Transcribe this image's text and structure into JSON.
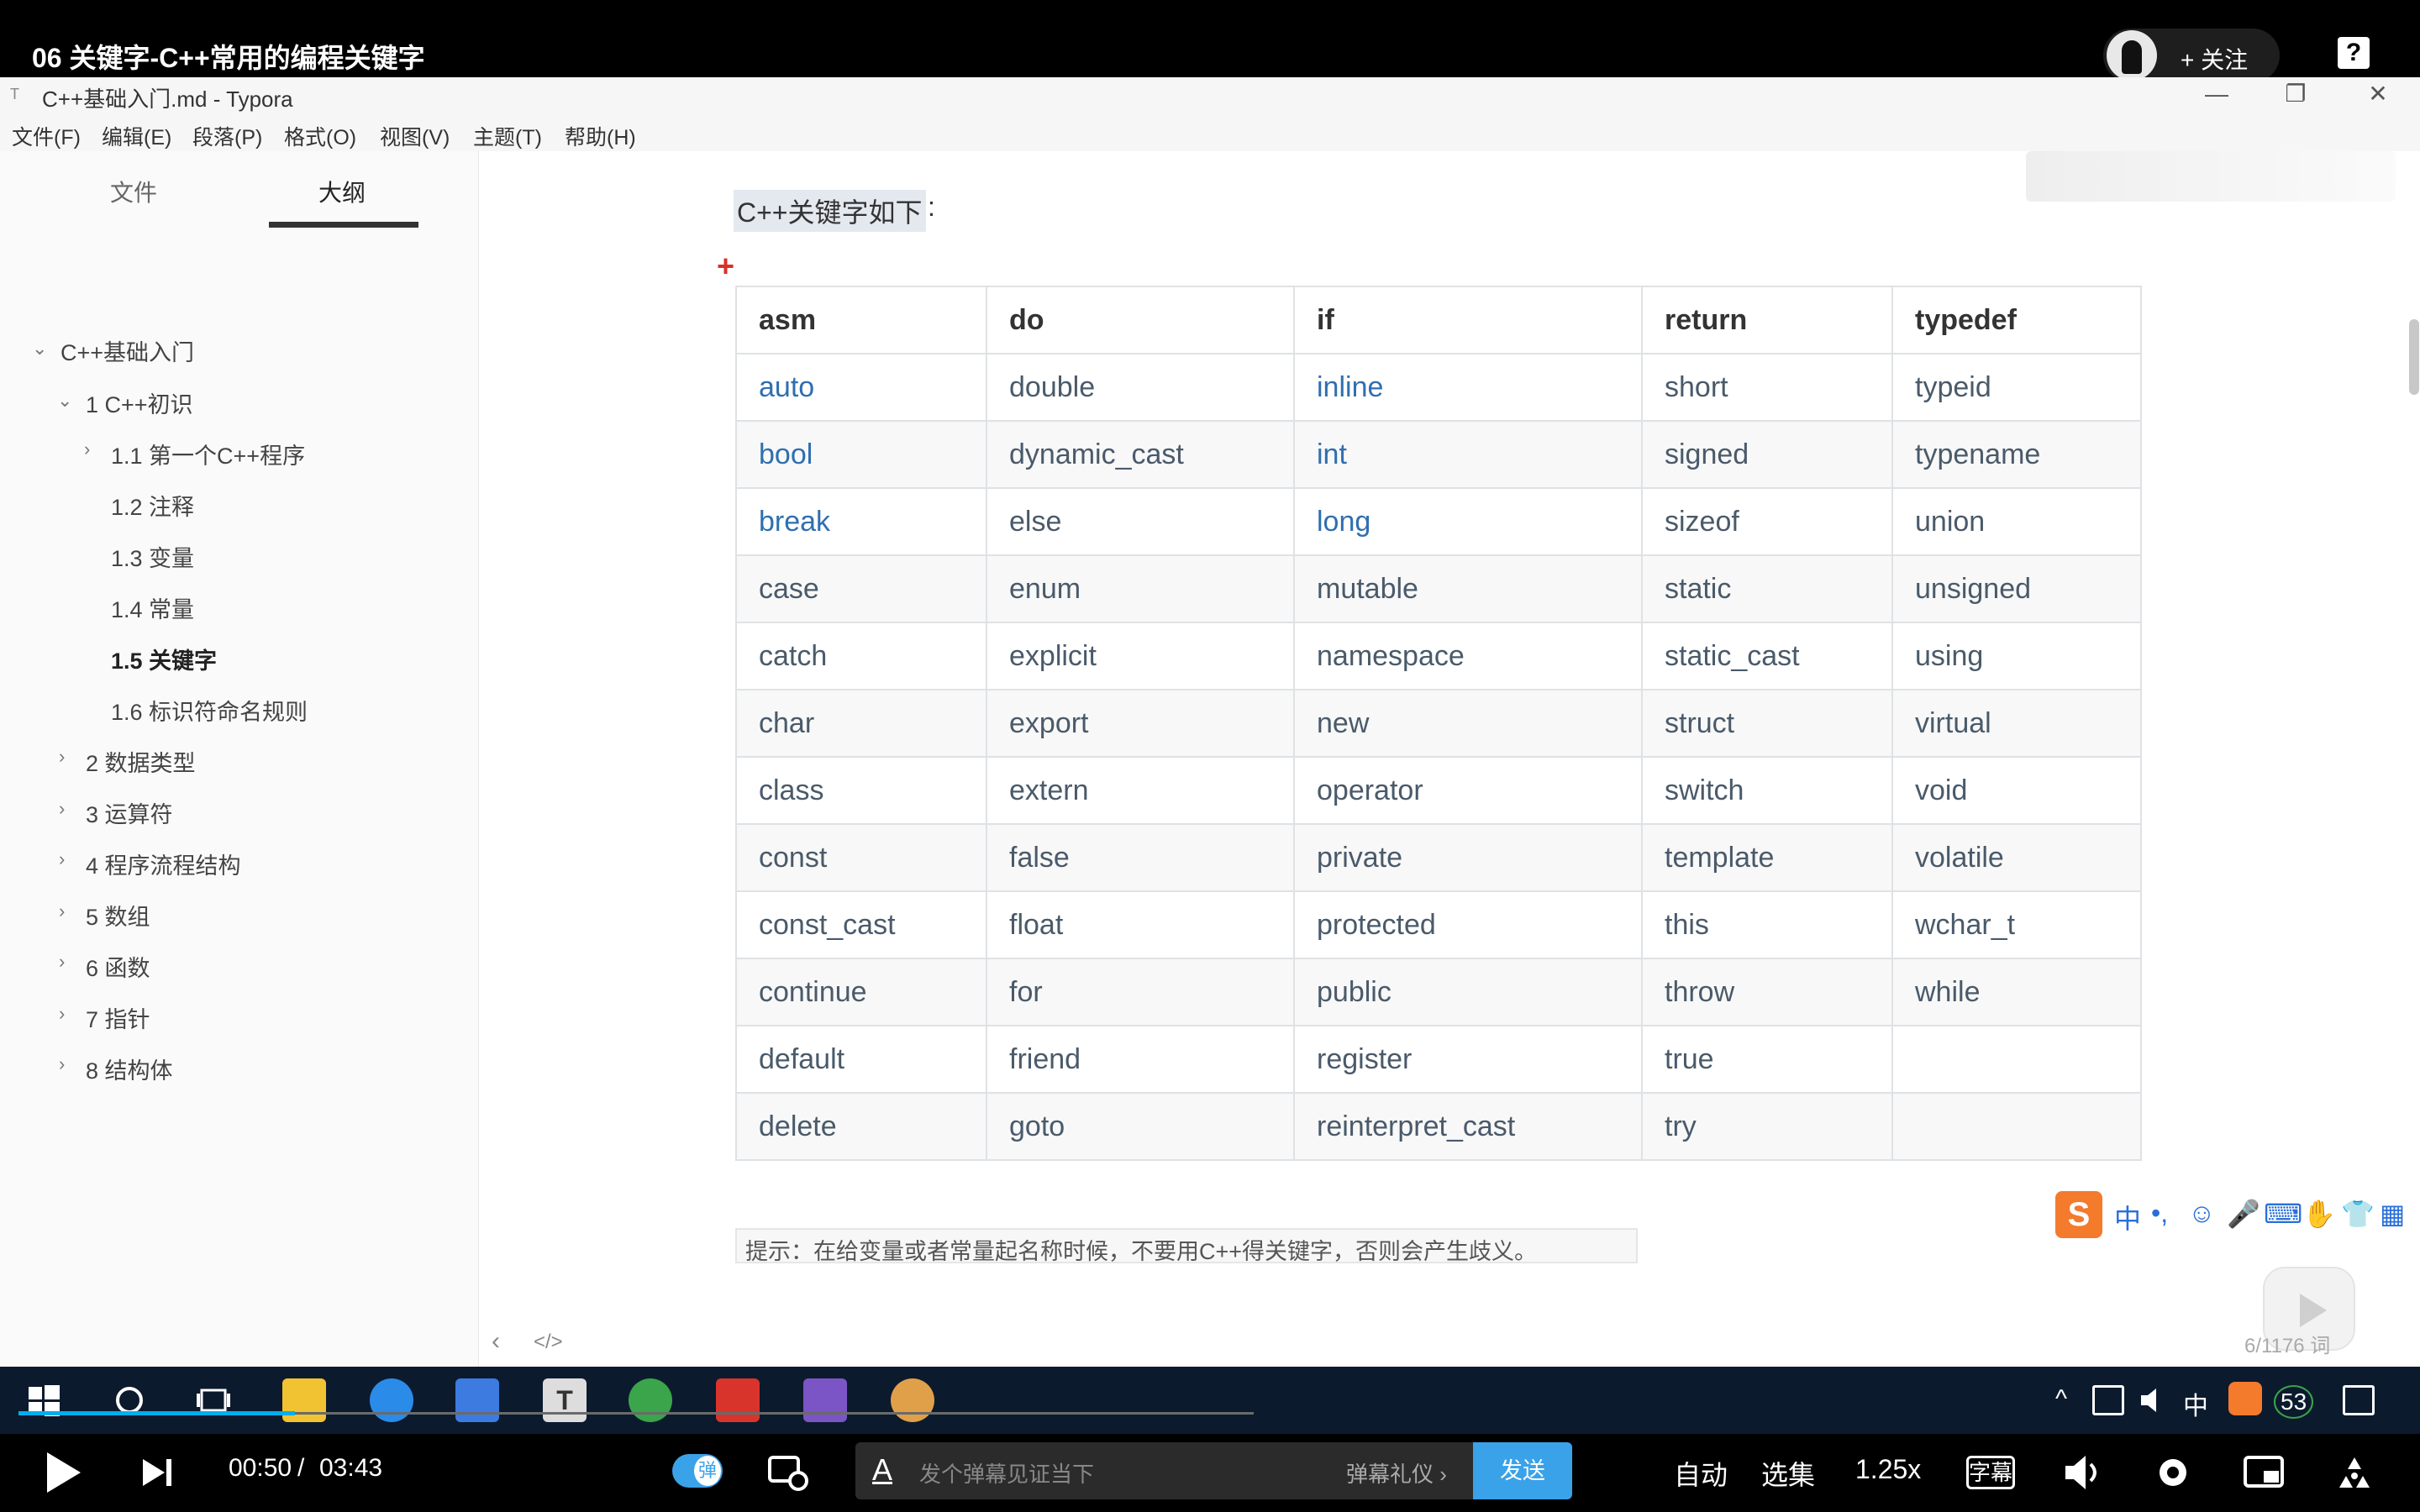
{
  "video": {
    "title": "06 关键字-C++常用的编程关键字",
    "follow_label": "+ 关注",
    "help_glyph": "?"
  },
  "window": {
    "title": "C++基础入门.md - Typora",
    "controls": {
      "minimize": "—",
      "restore": "❐",
      "close": "✕"
    },
    "menu": [
      "文件(F)",
      "编辑(E)",
      "段落(P)",
      "格式(O)",
      "视图(V)",
      "主题(T)",
      "帮助(H)"
    ]
  },
  "sidebar": {
    "tabs": [
      "文件",
      "大纲"
    ],
    "active_tab": "大纲",
    "outline": [
      {
        "label": "C++基础入门",
        "chevron": "⌄"
      },
      {
        "label": "1 C++初识",
        "chevron": "⌄"
      },
      {
        "label": "1.1 第一个C++程序",
        "chevron": "›"
      },
      {
        "label": "1.2 注释"
      },
      {
        "label": "1.3 变量"
      },
      {
        "label": "1.4 常量"
      },
      {
        "label": "1.5 关键字",
        "active": true
      },
      {
        "label": "1.6 标识符命名规则"
      },
      {
        "label": "2 数据类型",
        "chevron": "›"
      },
      {
        "label": "3 运算符",
        "chevron": "›"
      },
      {
        "label": "4 程序流程结构",
        "chevron": "›"
      },
      {
        "label": "5 数组",
        "chevron": "›"
      },
      {
        "label": "6 函数",
        "chevron": "›"
      },
      {
        "label": "7 指针",
        "chevron": "›"
      },
      {
        "label": "8 结构体",
        "chevron": "›"
      }
    ]
  },
  "content": {
    "intro": "C++关键字如下",
    "intro_colon": ":",
    "plus": "+",
    "table": {
      "headers": [
        "asm",
        "do",
        "if",
        "return",
        "typedef"
      ],
      "rows": [
        [
          "auto",
          "double",
          "inline",
          "short",
          "typeid"
        ],
        [
          "bool",
          "dynamic_cast",
          "int",
          "signed",
          "typename"
        ],
        [
          "break",
          "else",
          "long",
          "sizeof",
          "union"
        ],
        [
          "case",
          "enum",
          "mutable",
          "static",
          "unsigned"
        ],
        [
          "catch",
          "explicit",
          "namespace",
          "static_cast",
          "using"
        ],
        [
          "char",
          "export",
          "new",
          "struct",
          "virtual"
        ],
        [
          "class",
          "extern",
          "operator",
          "switch",
          "void"
        ],
        [
          "const",
          "false",
          "private",
          "template",
          "volatile"
        ],
        [
          "const_cast",
          "float",
          "protected",
          "this",
          "wchar_t"
        ],
        [
          "continue",
          "for",
          "public",
          "throw",
          "while"
        ],
        [
          "default",
          "friend",
          "register",
          "true",
          ""
        ],
        [
          "delete",
          "goto",
          "reinterpret_cast",
          "try",
          ""
        ]
      ],
      "blue_cells": [
        [
          0,
          0
        ],
        [
          0,
          2
        ],
        [
          1,
          0
        ],
        [
          1,
          2
        ],
        [
          2,
          0
        ],
        [
          2,
          2
        ]
      ]
    },
    "note": "提示：在给变量或者常量起名称时候，不要用C++得关键字，否则会产生歧义。",
    "nav_prev": "‹",
    "nav_code": "</>",
    "word_count": "6/1176 词"
  },
  "ime": {
    "logo": "S",
    "glyphs": [
      "中",
      "•,",
      "☺",
      "🎤",
      "⌨",
      "✋",
      "👕",
      "▦"
    ]
  },
  "taskbar": {
    "tray": [
      "^",
      "中",
      "53"
    ]
  },
  "player": {
    "current_time": "00:50",
    "separator": "/",
    "duration": "03:43",
    "progress_fraction": 0.224,
    "danmu_toggle_char": "弹",
    "danmu_placeholder": "发个弹幕见证当下",
    "danmu_gift": "弹幕礼仪 ›",
    "send_label": "发送",
    "auto_label": "自动",
    "episodes_label": "选集",
    "speed_label": "1.25x",
    "subtitle_label": "字幕"
  },
  "colors": {
    "accent_blue": "#3aa2e8",
    "table_link_blue": "#2f6fb0",
    "plus_red": "#d93025",
    "taskbar_bg": "#0c1a2e"
  }
}
